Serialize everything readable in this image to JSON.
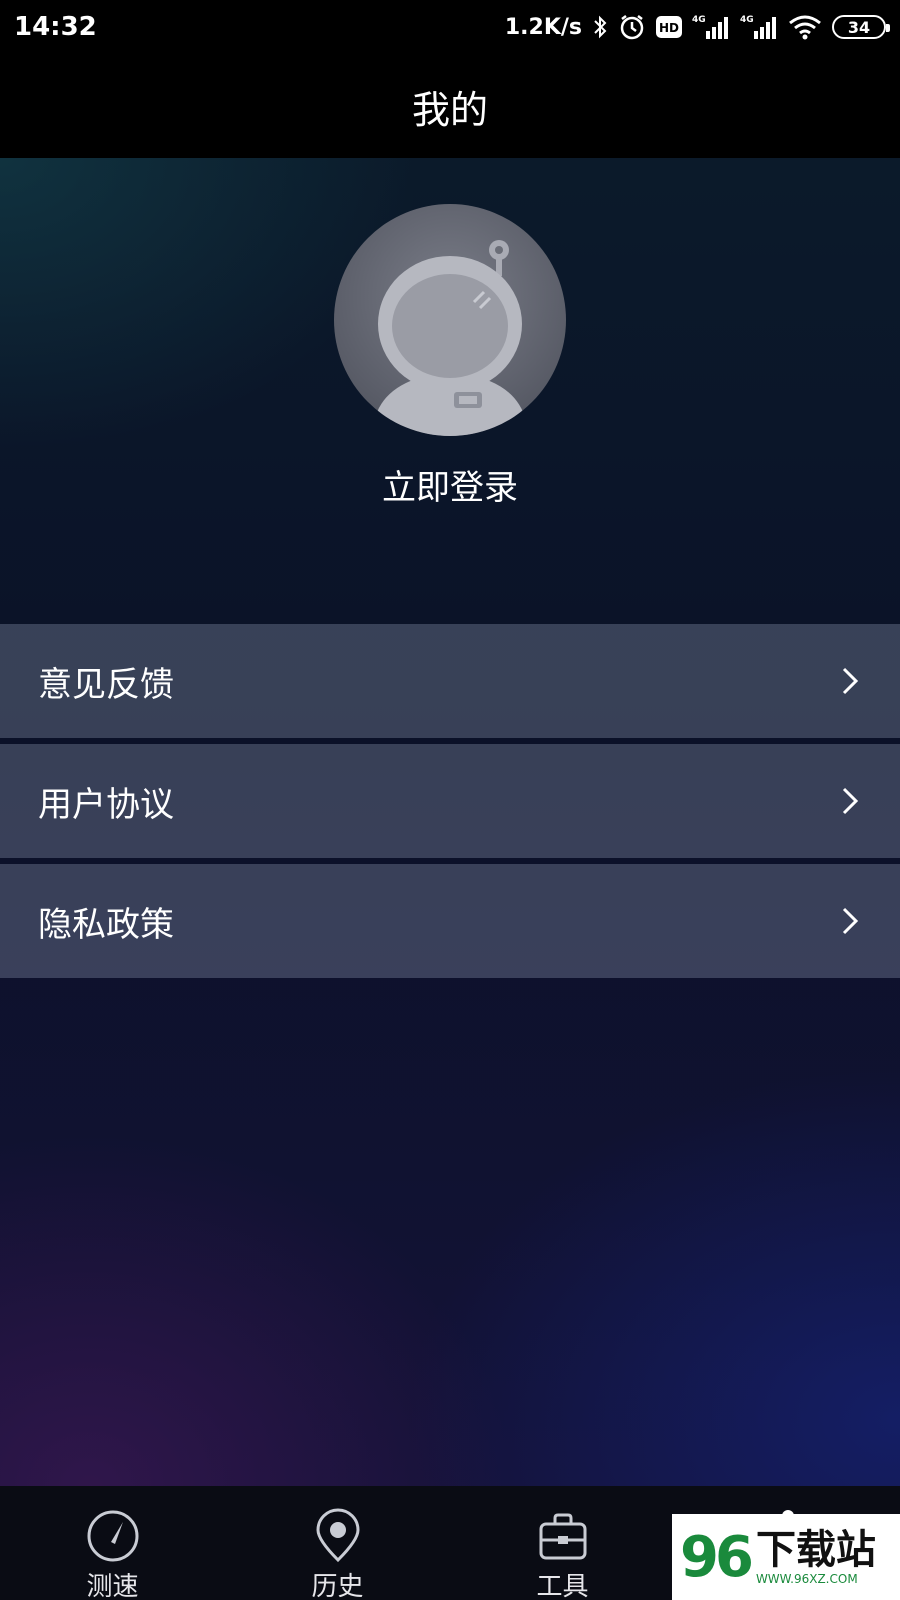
{
  "status_bar": {
    "time": "14:32",
    "net_speed": "1.2K/s",
    "hd": "HD",
    "signal1_label": "4G",
    "signal2_label": "4G",
    "battery": "34",
    "icons": [
      "bluetooth-icon",
      "alarm-icon",
      "hd-icon",
      "signal-icon",
      "signal-icon",
      "wifi-icon",
      "battery-icon"
    ]
  },
  "header": {
    "title": "我的"
  },
  "profile": {
    "avatar_icon": "astronaut-avatar",
    "login_label": "立即登录"
  },
  "menu": {
    "items": [
      {
        "label": "意见反馈",
        "icon": "chevron-right-icon"
      },
      {
        "label": "用户协议",
        "icon": "chevron-right-icon"
      },
      {
        "label": "隐私政策",
        "icon": "chevron-right-icon"
      }
    ]
  },
  "bottom_nav": {
    "items": [
      {
        "label": "测速",
        "icon": "speedometer-icon"
      },
      {
        "label": "历史",
        "icon": "location-pin-icon"
      },
      {
        "label": "工具",
        "icon": "toolbox-icon"
      },
      {
        "label": "",
        "icon": "profile-icon"
      }
    ]
  },
  "watermark": {
    "number": "96",
    "text": "下载站",
    "url": "WWW.96XZ.COM"
  },
  "colors": {
    "background": "#0b0f22",
    "menu_row": "#4a5064",
    "bar": "#000000",
    "watermark_green": "#1a8a3c"
  }
}
